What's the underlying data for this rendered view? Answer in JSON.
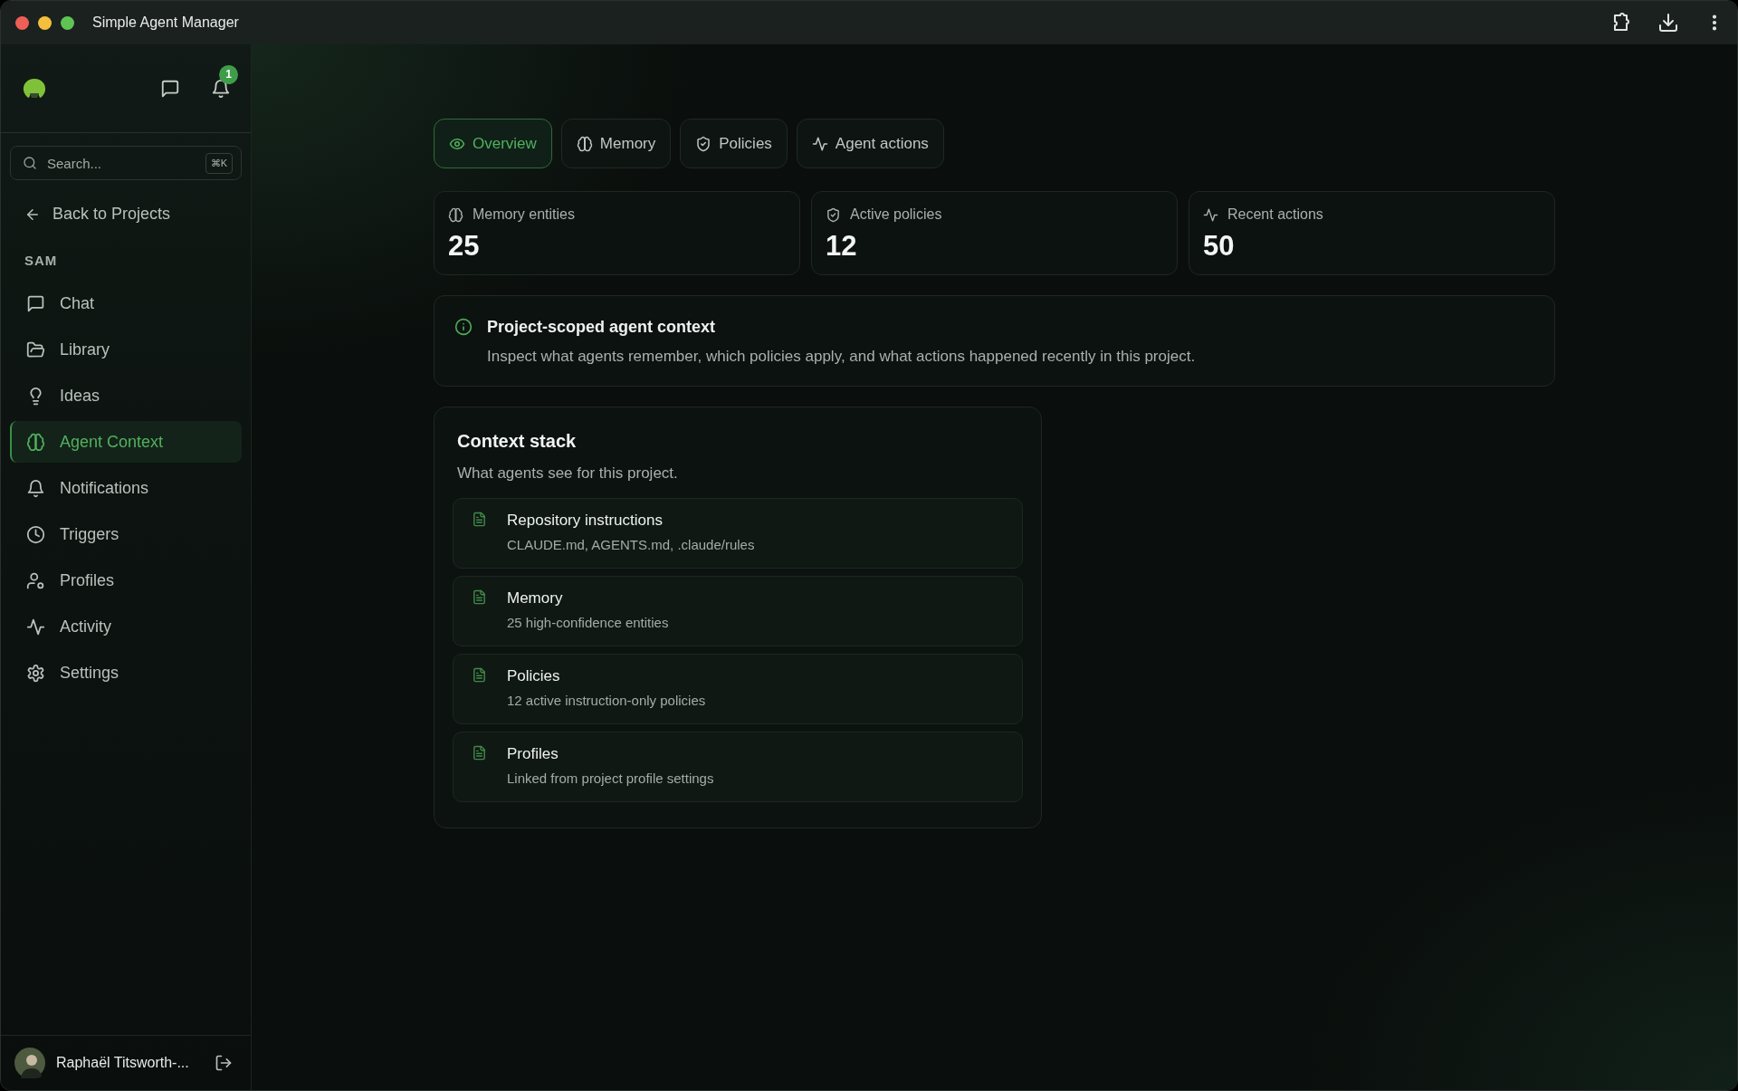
{
  "window": {
    "title": "Simple Agent Manager"
  },
  "sidebar": {
    "notification_count": "1",
    "search": {
      "placeholder": "Search...",
      "shortcut": "⌘K"
    },
    "back_link": "Back to Projects",
    "section": "SAM",
    "items": [
      {
        "label": "Chat",
        "selected": false
      },
      {
        "label": "Library",
        "selected": false
      },
      {
        "label": "Ideas",
        "selected": false
      },
      {
        "label": "Agent Context",
        "selected": true
      },
      {
        "label": "Notifications",
        "selected": false
      },
      {
        "label": "Triggers",
        "selected": false
      },
      {
        "label": "Profiles",
        "selected": false
      },
      {
        "label": "Activity",
        "selected": false
      },
      {
        "label": "Settings",
        "selected": false
      }
    ],
    "user": {
      "name": "Raphaël Titsworth-..."
    }
  },
  "tabs": [
    {
      "label": "Overview",
      "selected": true
    },
    {
      "label": "Memory",
      "selected": false
    },
    {
      "label": "Policies",
      "selected": false
    },
    {
      "label": "Agent actions",
      "selected": false
    }
  ],
  "stats": [
    {
      "label": "Memory entities",
      "value": "25"
    },
    {
      "label": "Active policies",
      "value": "12"
    },
    {
      "label": "Recent actions",
      "value": "50"
    }
  ],
  "info": {
    "title": "Project-scoped agent context",
    "text": "Inspect what agents remember, which policies apply, and what actions happened recently in this project."
  },
  "context_stack": {
    "title": "Context stack",
    "subtitle": "What agents see for this project.",
    "items": [
      {
        "title": "Repository instructions",
        "detail": "CLAUDE.md, AGENTS.md, .claude/rules"
      },
      {
        "title": "Memory",
        "detail": "25 high-confidence entities"
      },
      {
        "title": "Policies",
        "detail": "12 active instruction-only policies"
      },
      {
        "title": "Profiles",
        "detail": "Linked from project profile settings"
      }
    ]
  }
}
